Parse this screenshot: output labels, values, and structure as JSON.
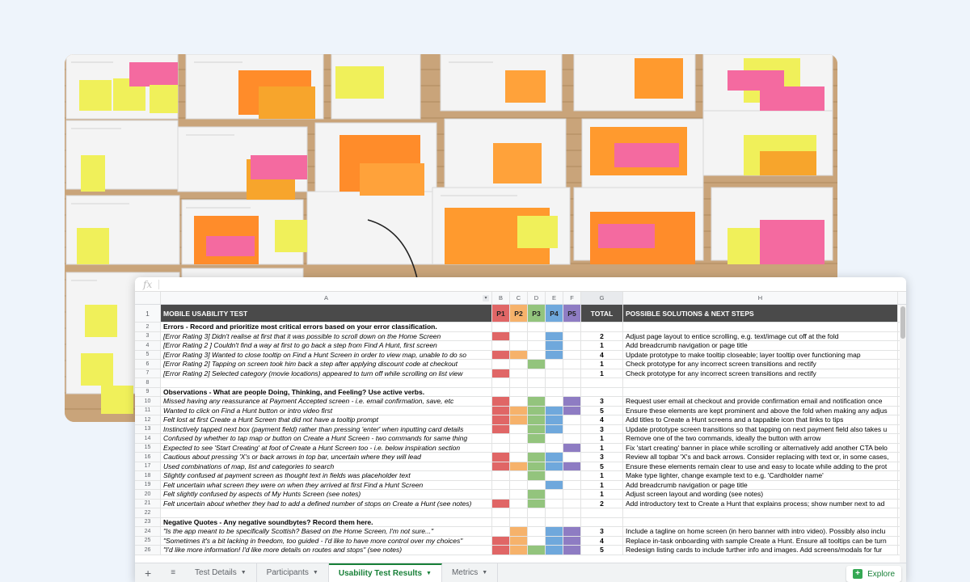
{
  "formula_bar": {
    "fx_label": "fx"
  },
  "columns": [
    "",
    "A",
    "B",
    "C",
    "D",
    "E",
    "F",
    "G",
    "H"
  ],
  "header_row": {
    "num": "1",
    "a": "MOBILE USABILITY TEST",
    "p": [
      "P1",
      "P2",
      "P3",
      "P4",
      "P5"
    ],
    "g": "TOTAL",
    "h": "POSSIBLE SOLUTIONS & NEXT STEPS"
  },
  "colors": {
    "p1": "#e06666",
    "p2": "#f6b26b",
    "p3": "#93c47d",
    "p4": "#6fa8dc",
    "p5": "#8e7cc3",
    "header_bg": "#4a4a4a",
    "accent": "#188038"
  },
  "rows": [
    {
      "num": "2",
      "type": "sec",
      "a": "Errors - Record and prioritize most critical errors based on your error classification.",
      "cells": [
        0,
        0,
        0,
        0,
        0
      ],
      "g": "",
      "h": ""
    },
    {
      "num": "3",
      "type": "it",
      "a": "[Error Rating 3] Didn't realise at first that it was possible to scroll down on the Home Screen",
      "cells": [
        1,
        0,
        0,
        1,
        0
      ],
      "g": "2",
      "h": "Adjust page layout to entice scrolling, e.g. text/image cut off at the fold"
    },
    {
      "num": "4",
      "type": "it",
      "a": "[Error Rating 2 ] Couldn't find a way at first to go back a step from Find A Hunt, first screen",
      "cells": [
        0,
        0,
        0,
        1,
        0
      ],
      "g": "1",
      "h": "Add breadcrumb navigation or page title"
    },
    {
      "num": "5",
      "type": "it",
      "a": "[Error Rating 3] Wanted to close tooltip on Find a Hunt Screen in order to view map, unable to do so",
      "cells": [
        1,
        1,
        0,
        1,
        0
      ],
      "g": "4",
      "h": "Update prototype to make tooltip closeable; layer tooltip over functioning map"
    },
    {
      "num": "6",
      "type": "it",
      "a": "[Error Rating 2] Tapping on screen took him back a step after applying discount code at checkout",
      "cells": [
        0,
        0,
        1,
        0,
        0
      ],
      "g": "1",
      "h": "Check prototype for any incorrect screen transitions and rectify"
    },
    {
      "num": "7",
      "type": "it",
      "a": "[Error Rating 2] Selected category (movie locations) appeared to turn off while scrolling on list view",
      "cells": [
        1,
        0,
        0,
        0,
        0
      ],
      "g": "1",
      "h": "Check prototype for any incorrect screen transitions and rectify"
    },
    {
      "num": "8",
      "type": "blank",
      "a": "",
      "cells": [
        0,
        0,
        0,
        0,
        0
      ],
      "g": "",
      "h": ""
    },
    {
      "num": "9",
      "type": "sec",
      "a": "Observations - What are people Doing, Thinking, and Feeling? Use active verbs.",
      "cells": [
        0,
        0,
        0,
        0,
        0
      ],
      "g": "",
      "h": ""
    },
    {
      "num": "10",
      "type": "it",
      "a": "Missed having any reassurance at Payment Accepted screen - i.e. email confirmation, save, etc",
      "cells": [
        1,
        0,
        1,
        0,
        1
      ],
      "g": "3",
      "h": "Request user email at checkout and provide confirmation email and notification once"
    },
    {
      "num": "11",
      "type": "it",
      "a": "Wanted to click on Find a Hunt button or intro video first",
      "cells": [
        1,
        1,
        1,
        1,
        1
      ],
      "g": "5",
      "h": "Ensure these elements are kept prominent and above the fold when making any adjus"
    },
    {
      "num": "12",
      "type": "it",
      "a": "Felt lost at first Create a Hunt Screen that did not have a tooltip prompt",
      "cells": [
        1,
        1,
        1,
        1,
        0
      ],
      "g": "4",
      "h": "Add titles to Create a Hunt screens and a tappable icon that links to tips"
    },
    {
      "num": "13",
      "type": "it",
      "a": "Instinctively tapped next box (payment field) rather than pressing 'enter' when inputting card details",
      "cells": [
        1,
        0,
        1,
        1,
        0
      ],
      "g": "3",
      "h": "Update prototype screen transitions so that tapping on next payment field also takes u"
    },
    {
      "num": "14",
      "type": "it",
      "a": "Confused by whether to tap map or button on Create a Hunt Screen - two commands for same thing",
      "cells": [
        0,
        0,
        1,
        0,
        0
      ],
      "g": "1",
      "h": "Remove one of the two commands, ideally the button with arrow"
    },
    {
      "num": "15",
      "type": "it",
      "a": "Expected to see 'Start Creating' at foot of Create a Hunt Screen too - i.e. below inspiration section",
      "cells": [
        0,
        0,
        0,
        0,
        1
      ],
      "g": "1",
      "h": "Fix 'start creating' banner in place while scrolling or alternatively add another CTA belo"
    },
    {
      "num": "16",
      "type": "it",
      "a": "Cautious about pressing 'X's or back arrows in top bar, uncertain where they will lead",
      "cells": [
        1,
        0,
        1,
        1,
        0
      ],
      "g": "3",
      "h": "Review all topbar 'X's and back arrows. Consider replacing with text or, in some cases,"
    },
    {
      "num": "17",
      "type": "it",
      "a": "Used combinations of map, list and categories to search",
      "cells": [
        1,
        1,
        1,
        1,
        1
      ],
      "g": "5",
      "h": "Ensure these elements remain clear to use and easy to locate while adding to the prot"
    },
    {
      "num": "18",
      "type": "it",
      "a": "Slightly confused at payment screen as thought text in fields was placeholder text",
      "cells": [
        0,
        0,
        1,
        0,
        0
      ],
      "g": "1",
      "h": "Make type lighter, change example text to e.g. 'Cardholder name'"
    },
    {
      "num": "19",
      "type": "it",
      "a": "Felt uncertain what screen they were on when they arrived at first Find a Hunt Screen",
      "cells": [
        0,
        0,
        0,
        1,
        0
      ],
      "g": "1",
      "h": "Add breadcrumb navigation or page title"
    },
    {
      "num": "20",
      "type": "it",
      "a": "Felt slightly confused by aspects of My Hunts Screen (see notes)",
      "cells": [
        0,
        0,
        1,
        0,
        0
      ],
      "g": "1",
      "h": "Adjust screen layout and wording (see notes)"
    },
    {
      "num": "21",
      "type": "it",
      "a": "Felt uncertain about whether they had to add a defined number of stops on Create a Hunt (see notes)",
      "cells": [
        1,
        0,
        1,
        0,
        0
      ],
      "g": "2",
      "h": "Add introductory text to Create a Hunt that explains process; show number next to ad"
    },
    {
      "num": "22",
      "type": "blank",
      "a": "",
      "cells": [
        0,
        0,
        0,
        0,
        0
      ],
      "g": "",
      "h": ""
    },
    {
      "num": "23",
      "type": "sec",
      "a": "Negative Quotes - Any negative soundbytes? Record them here.",
      "cells": [
        0,
        0,
        0,
        0,
        0
      ],
      "g": "",
      "h": ""
    },
    {
      "num": "24",
      "type": "it",
      "a": "\"Is the app meant to be specifically Scottish? Based on the Home Screen, I'm not sure...\"",
      "cells": [
        0,
        1,
        0,
        1,
        1
      ],
      "g": "3",
      "h": "Include a tagline on home screen (in hero banner with intro video). Possibly also inclu"
    },
    {
      "num": "25",
      "type": "it",
      "a": "\"Sometimes it's a bit lacking in freedom, too guided -  I'd like to have more control over my choices\"",
      "cells": [
        1,
        1,
        0,
        1,
        1
      ],
      "g": "4",
      "h": "Replace in-task onboarding with sample Create a Hunt. Ensure all tooltips can be turn"
    },
    {
      "num": "26",
      "type": "it",
      "a": "\"I'd like more information! I'd like more details on routes and stops\" (see notes)",
      "cells": [
        1,
        1,
        1,
        1,
        1
      ],
      "g": "5",
      "h": "Redesign listing cards to include further info and images. Add screens/modals for fur"
    }
  ],
  "tabs": {
    "add": "+",
    "menu": "≡",
    "items": [
      {
        "label": "Test Details",
        "active": false
      },
      {
        "label": "Participants",
        "active": false
      },
      {
        "label": "Usability Test Results",
        "active": true
      },
      {
        "label": "Metrics",
        "active": false
      }
    ],
    "explore": "Explore"
  }
}
